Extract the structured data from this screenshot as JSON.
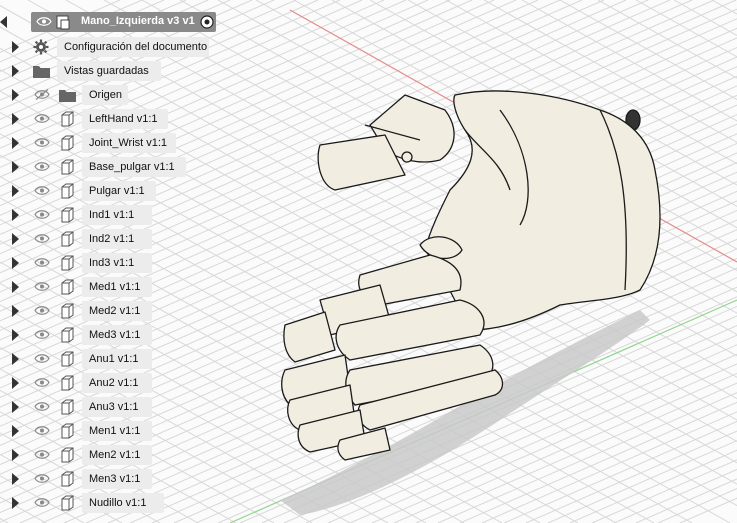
{
  "browser": {
    "root": {
      "label": "Mano_Izquierda v3 v1"
    },
    "settings": {
      "label": "Configuración del documento",
      "icon": "gear-icon"
    },
    "named_views": {
      "label": "Vistas guardadas",
      "icon": "folder-icon"
    },
    "origin": {
      "label": "Origen",
      "icon": "folder-icon"
    },
    "components": [
      "LeftHand v1:1",
      "Joint_Wrist v1:1",
      "Base_pulgar v1:1",
      "Pulgar v1:1",
      "Ind1 v1:1",
      "Ind2 v1:1",
      "Ind3 v1:1",
      "Med1 v1:1",
      "Med2 v1:1",
      "Med3 v1:1",
      "Anu1 v1:1",
      "Anu2 v1:1",
      "Anu3 v1:1",
      "Men1 v1:1",
      "Men2 v1:1",
      "Men3 v1:1",
      "Nudillo v1:1"
    ]
  },
  "colors": {
    "model_fill": "#f2ede1",
    "grid": "#d7d7d7",
    "axis_red": "#e58b8b",
    "axis_green": "#8fd48f",
    "root_highlight": "#8a8a8a"
  }
}
